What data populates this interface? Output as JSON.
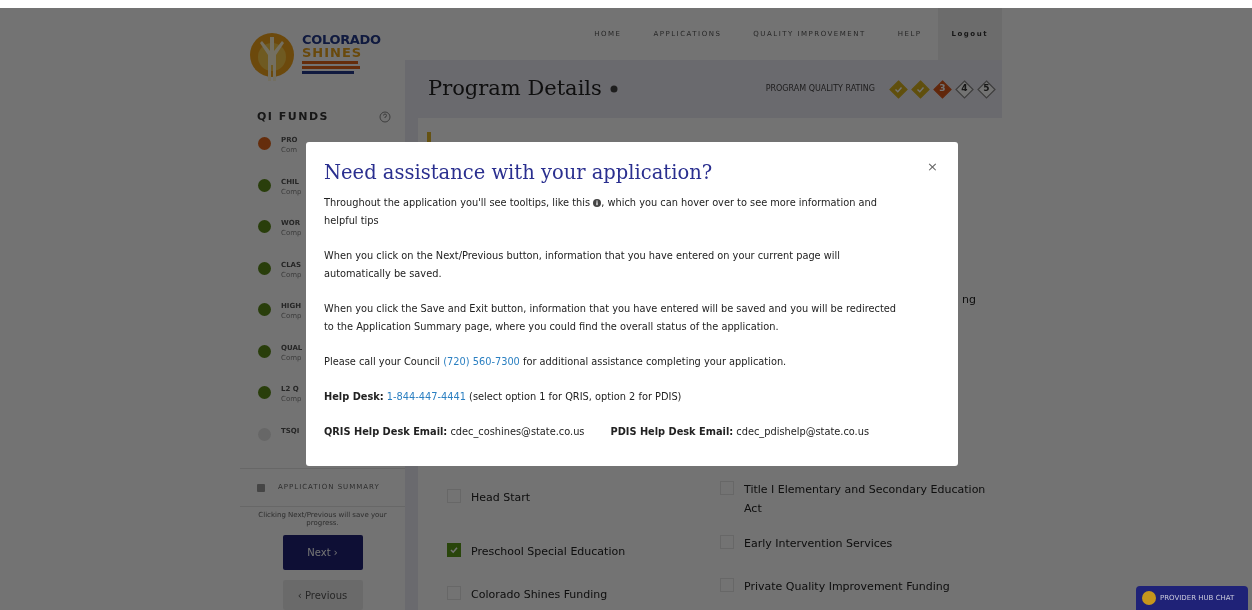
{
  "logo": {
    "lines": [
      "COLORADO",
      "SHINES"
    ]
  },
  "nav": [
    {
      "label": "HOME",
      "kind": "link"
    },
    {
      "label": "APPLICATIONS",
      "kind": "link"
    },
    {
      "label": "QUALITY IMPROVEMENT",
      "kind": "link"
    },
    {
      "label": "HELP",
      "kind": "link"
    },
    {
      "label": "Logout",
      "kind": "logout"
    }
  ],
  "sidebar": {
    "title": "QI FUNDS",
    "steps": [
      {
        "label": "PRO",
        "sub": "Com",
        "kind": "current"
      },
      {
        "label": "CHIL",
        "sub": "Comp",
        "kind": "done"
      },
      {
        "label": "WOR",
        "sub": "Comp",
        "kind": "done"
      },
      {
        "label": "CLAS",
        "sub": "Comp",
        "kind": "done"
      },
      {
        "label": "HIGH",
        "sub": "Comp",
        "kind": "done"
      },
      {
        "label": "QUAL",
        "sub": "Comp",
        "kind": "done"
      },
      {
        "label": "L2 Q",
        "sub": "Comp",
        "kind": "done"
      },
      {
        "label": "TSQI",
        "kind": "pending"
      }
    ],
    "summary": "APPLICATION SUMMARY",
    "note": "Clicking Next/Previous will save your progress.",
    "next": "Next ›",
    "previous": "‹ Previous"
  },
  "page": {
    "title": "Program Details",
    "rating_label": "PROGRAM QUALITY RATING",
    "rating": [
      {
        "kind": "done"
      },
      {
        "kind": "done"
      },
      {
        "kind": "current",
        "label": "3"
      },
      {
        "kind": "empty",
        "label": "4"
      },
      {
        "kind": "empty",
        "label": "5"
      }
    ],
    "cut_text": "ng",
    "funding": [
      {
        "left": {
          "label": "Head Start",
          "checked": false
        },
        "right": {
          "label": "Title I Elementary and Secondary Education Act",
          "checked": false
        }
      },
      {
        "left": {
          "label": "Preschool Special Education",
          "checked": true
        },
        "right": {
          "label": "Early Intervention Services",
          "checked": false
        }
      },
      {
        "left": {
          "label": "Colorado Shines Funding",
          "checked": false
        },
        "right": {
          "label": "Private Quality Improvement Funding",
          "checked": false
        }
      }
    ]
  },
  "chat_button": "PROVIDER HUB CHAT",
  "modal": {
    "title": "Need assistance with your application?",
    "close": "×",
    "tooltip": {
      "before": "Throughout the application you'll see tooltips, like this",
      "after": ", which you can hover over to see more information and helpful tips"
    },
    "paragraphs": [
      "When you click on the Next/Previous button, information that you have entered on your current page will automatically be saved.",
      "When you click the Save and Exit button, information that you have entered will be saved and you will be redirected to the Application Summary page, where you could find the overall status of the application."
    ],
    "council": {
      "before": "Please call your Council",
      "link": "(720) 560-7300",
      "after": "for additional assistance completing your application."
    },
    "help_desk": {
      "before": "**Help Desk:**",
      "link": "1-844-447-4441",
      "after": "(select option 1 for QRIS, option 2 for PDIS)"
    },
    "emails": [
      "**QRIS Help Desk Email:** cdec_coshines@state.co.us",
      "**PDIS Help Desk Email:** cdec_pdishelp@state.co.us"
    ]
  }
}
